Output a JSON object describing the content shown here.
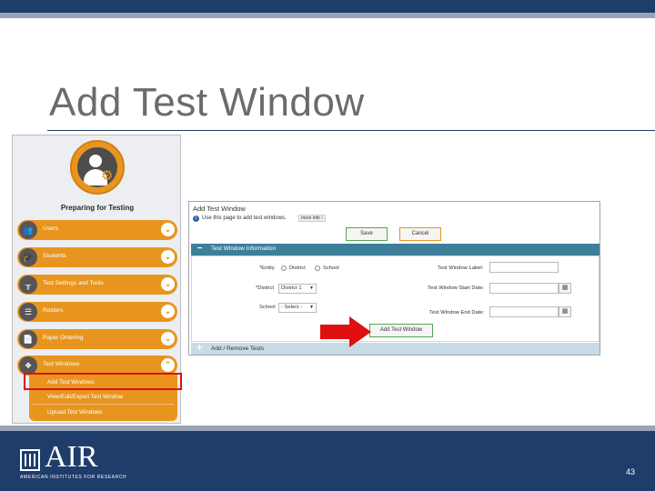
{
  "slide": {
    "title": "Add Test Window",
    "page_number": "43"
  },
  "nav_panel": {
    "heading": "Preparing for Testing",
    "items": [
      {
        "label": "Users",
        "icon": "users-icon",
        "chevron": "chevron-down-icon"
      },
      {
        "label": "Students",
        "icon": "graduation-cap-icon",
        "chevron": "chevron-down-icon"
      },
      {
        "label": "Test Settings and Tools",
        "icon": "settings-tools-icon",
        "chevron": "chevron-down-icon"
      },
      {
        "label": "Rosters",
        "icon": "rosters-icon",
        "chevron": "chevron-down-icon"
      },
      {
        "label": "Paper Ordering",
        "icon": "paper-icon",
        "chevron": "chevron-down-icon"
      },
      {
        "label": "Test Windows",
        "icon": "test-windows-icon",
        "chevron": "chevron-up-icon"
      }
    ],
    "submenu": [
      "Add Test Windows",
      "View/Edit/Export Test Window",
      "Upload Test Windows"
    ],
    "highlight_color": "#e01010"
  },
  "form": {
    "title": "Add Test Window",
    "info_text": "Use this page to add test windows.",
    "more_info": "more info ›",
    "save_label": "Save",
    "cancel_label": "Cancel",
    "section_title": "Test Window Information",
    "section_toggle": "−",
    "entity_label": "*Entity",
    "entity_options": [
      "District",
      "School"
    ],
    "district_label": "*District",
    "district_value": "District 1",
    "school_label": "School",
    "school_value": "- Select -",
    "label_field": "Test Window Label:",
    "start_field": "Test Window Start Date:",
    "end_field": "Test Window End Date:",
    "add_button": "Add Test Window",
    "bottom_section": "Add / Remove Tests",
    "bottom_toggle": "+"
  },
  "footer": {
    "logo_text": "AIR",
    "logo_subtext": "AMERICAN INSTITUTES FOR RESEARCH"
  },
  "colors": {
    "brand_navy": "#1f3d6b",
    "nav_orange": "#e8951f",
    "section_teal": "#3d7f9a",
    "arrow_red": "#e01010"
  }
}
